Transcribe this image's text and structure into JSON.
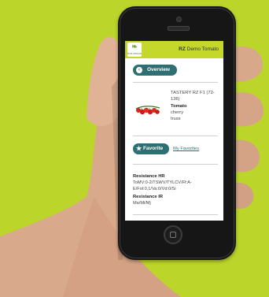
{
  "app": {
    "logo_text": "RIJK ZWAAN",
    "title_bold": "RZ",
    "title_rest": "Demo Tomato"
  },
  "nav": {
    "overview_label": "Overview"
  },
  "product": {
    "name": "TASTERY RZ F1 (72-136)",
    "crop": "Tomato",
    "type": "cherry",
    "shape": "truss"
  },
  "actions": {
    "favorite_label": "Favorite",
    "my_favorites_label": "My Favorites"
  },
  "resistance": {
    "hr_title": "Resistance HR",
    "hr_text": "ToMV:0-2/TSWV/TYLCV/Ff:A-E/Fol:0,1/Va:0/Vd:0/Si",
    "ir_title": "Resistance IR",
    "ir_text": "Ma/Mi/Mj"
  },
  "colors": {
    "background": "#bcd52a",
    "header": "#c4d82b",
    "accent": "#2e6f73"
  },
  "icons": {
    "back": "chevron-left-icon",
    "favorite": "star-icon"
  }
}
